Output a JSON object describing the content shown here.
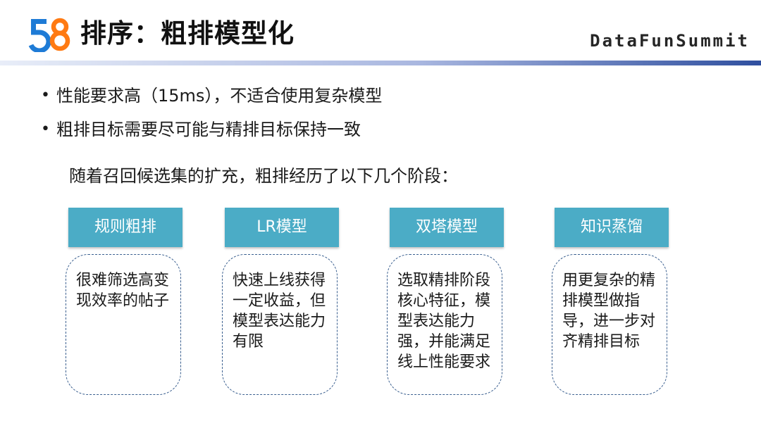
{
  "header": {
    "logo_text": "58",
    "title": "排序：粗排模型化",
    "brand": "DataFunSummit"
  },
  "bullets": [
    "性能要求高（15ms），不适合使用复杂模型",
    "粗排目标需要尽可能与精排目标保持一致"
  ],
  "bullet_marker": "•",
  "intro": "随着召回候选集的扩充，粗排经历了以下几个阶段：",
  "stages": [
    {
      "title": "规则粗排",
      "description": "很难筛选高变现效率的帖子"
    },
    {
      "title": "LR模型",
      "description": "快速上线获得一定收益，但模型表达能力有限"
    },
    {
      "title": "双塔模型",
      "description": "选取精排阶段核心特征，模型表达能力强，并能满足线上性能要求"
    },
    {
      "title": "知识蒸馏",
      "description": "用更复杂的精排模型做指导，进一步对齐精排目标"
    }
  ],
  "colors": {
    "stage_header": "#4bacc6",
    "dashed_border": "#3a5f8f",
    "rule_dark": "#2f4f9f",
    "rule_light": "#cfd8ee",
    "logo_blue": "#1e7bd6",
    "logo_orange": "#ff7a12"
  }
}
